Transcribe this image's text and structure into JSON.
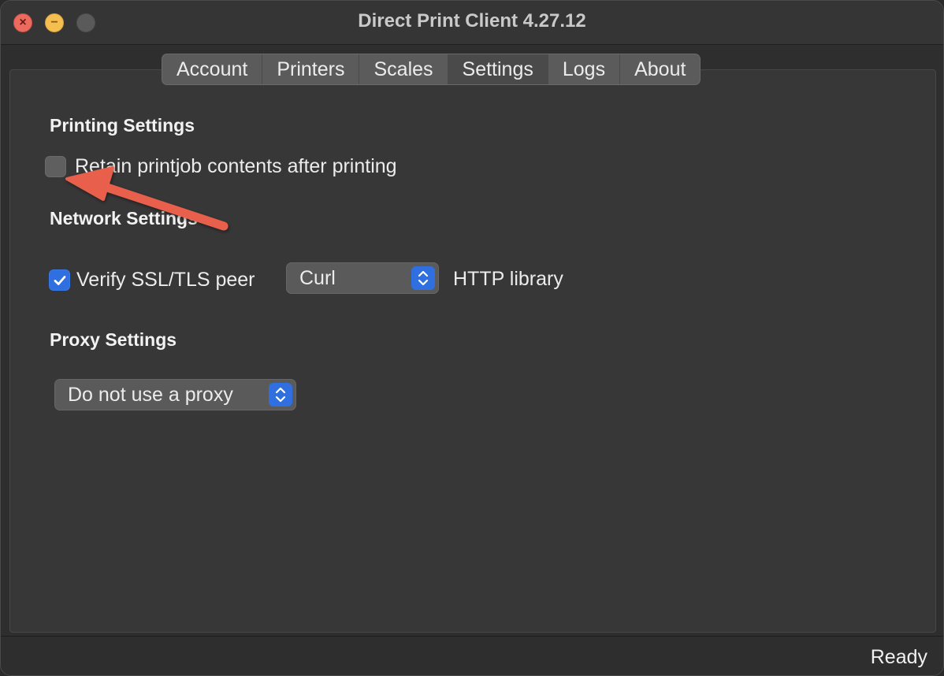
{
  "window": {
    "title": "Direct Print Client 4.27.12"
  },
  "tabs": [
    {
      "label": "Account"
    },
    {
      "label": "Printers"
    },
    {
      "label": "Scales"
    },
    {
      "label": "Settings"
    },
    {
      "label": "Logs"
    },
    {
      "label": "About"
    }
  ],
  "active_tab": "Settings",
  "printing": {
    "title": "Printing Settings",
    "retain_label": "Retain printjob contents after printing",
    "retain_checked": false
  },
  "network": {
    "title": "Network Settings",
    "verify_label": "Verify SSL/TLS peer",
    "verify_checked": true,
    "http_library_value": "Curl",
    "http_library_label": "HTTP library"
  },
  "proxy": {
    "title": "Proxy Settings",
    "value": "Do not use a proxy"
  },
  "status": {
    "text": "Ready"
  },
  "colors": {
    "accent": "#2f6fe0",
    "annotation": "#e8604c"
  },
  "icons": {
    "close": "close-icon",
    "minimize": "minimize-icon",
    "maximize": "maximize-icon",
    "checkmark": "checkmark-icon",
    "stepper": "chevron-updown-icon",
    "annotation": "arrow-icon"
  }
}
